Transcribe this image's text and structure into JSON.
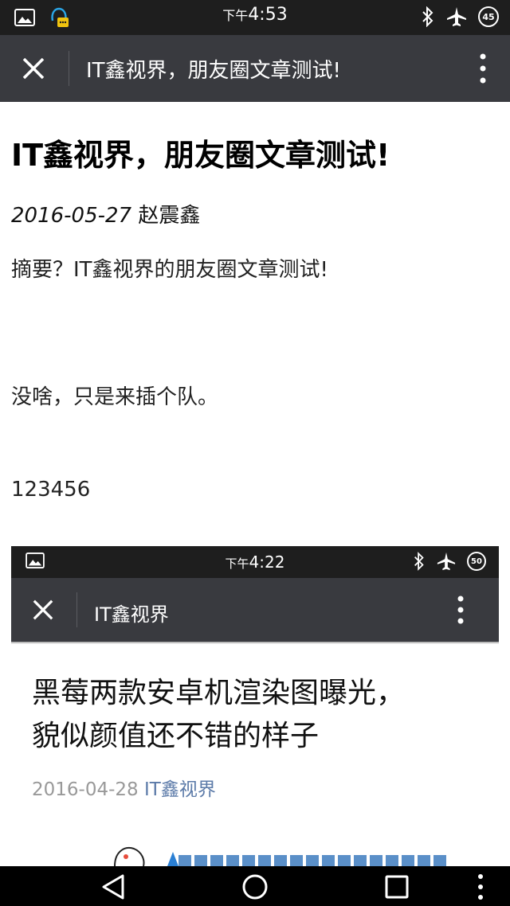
{
  "status_bar": {
    "ampm": "下午",
    "time": "4:53",
    "battery_level": "45",
    "icons": [
      "image-icon",
      "qq-icon",
      "bluetooth-icon",
      "airplane-icon",
      "battery-icon"
    ]
  },
  "action_bar": {
    "title": "IT鑫视界，朋友圈文章测试!",
    "icons": [
      "close-icon",
      "more-vertical-icon"
    ]
  },
  "article": {
    "title": "IT鑫视界，朋友圈文章测试!",
    "date": "2016-05-27",
    "author": "赵震鑫",
    "summary": "摘要？IT鑫视界的朋友圈文章测试!",
    "paragraph_1": "没啥，只是来插个队。",
    "paragraph_2": "123456"
  },
  "embedded_screenshot": {
    "status_ampm": "下午",
    "status_time": "4:22",
    "battery_level": "50",
    "action_title": "IT鑫视界",
    "headline_line1": "黑莓两款安卓机渲染图曝光，",
    "headline_line2": "貌似颜值还不错的样子",
    "date": "2016-04-28",
    "author": "IT鑫视界"
  },
  "nav_bar": {
    "icons": [
      "back-icon",
      "home-icon",
      "recents-icon",
      "more-vertical-icon"
    ]
  },
  "colors": {
    "status_bar": "#1e1e1e",
    "action_bar": "#393a3f",
    "author_link": "#5b7aa8"
  }
}
